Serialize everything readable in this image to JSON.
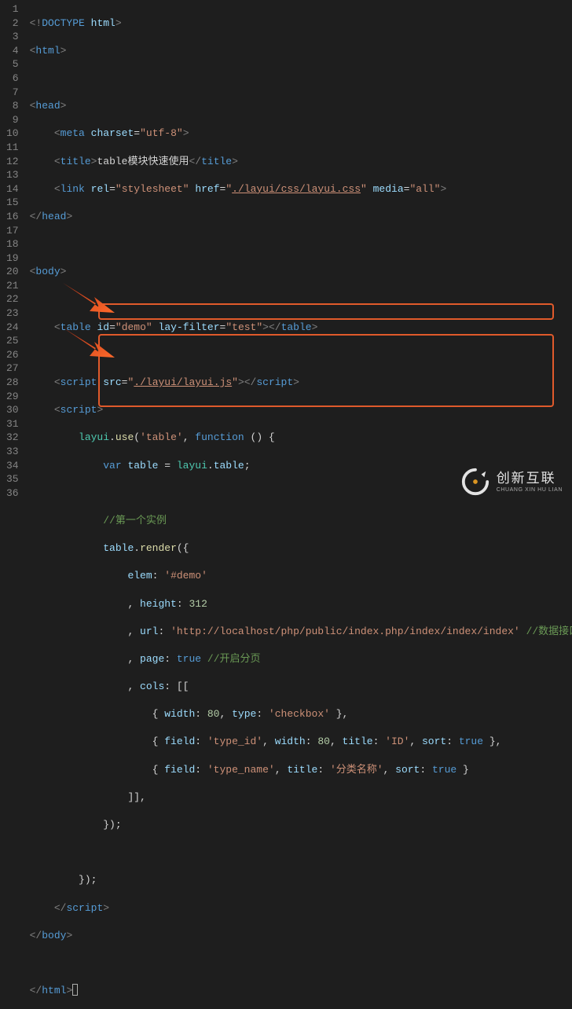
{
  "lines": [
    "1",
    "2",
    "3",
    "4",
    "5",
    "6",
    "7",
    "8",
    "9",
    "10",
    "11",
    "12",
    "13",
    "14",
    "15",
    "16",
    "17",
    "18",
    "19",
    "20",
    "21",
    "22",
    "23",
    "24",
    "25",
    "26",
    "27",
    "28",
    "29",
    "30",
    "31",
    "32",
    "33",
    "34",
    "35",
    "36"
  ],
  "code": {
    "l1": {
      "doctype": "DOCTYPE",
      "html": "html"
    },
    "l2": {
      "tag": "html"
    },
    "l4": {
      "tag": "head"
    },
    "l5": {
      "tag": "meta",
      "attr": "charset",
      "val": "\"utf-8\""
    },
    "l6": {
      "open": "title",
      "text": "table模块快速使用",
      "close": "title"
    },
    "l7": {
      "tag": "link",
      "a1": "rel",
      "v1": "\"stylesheet\"",
      "a2": "href",
      "v2": "\"",
      "href": "./layui/css/layui.css",
      "v2b": "\"",
      "a3": "media",
      "v3": "\"all\""
    },
    "l8": {
      "close": "head"
    },
    "l10": {
      "tag": "body"
    },
    "l12": {
      "tag": "table",
      "a1": "id",
      "v1": "\"demo\"",
      "a2": "lay-filter",
      "v2": "\"test\"",
      "close": "table"
    },
    "l14": {
      "tag": "script",
      "a1": "src",
      "v1": "\"",
      "src": "./layui/layui.js",
      "v1b": "\"",
      "close": "script"
    },
    "l15": {
      "tag": "script"
    },
    "l16": {
      "obj": "layui",
      "use": "use",
      "arg": "'table'",
      "kw": "function"
    },
    "l17": {
      "kw": "var",
      "name": "table",
      "obj": "layui",
      "prop": "table"
    },
    "l19": {
      "comment": "//第一个实例"
    },
    "l20": {
      "obj": "table",
      "fn": "render"
    },
    "l21": {
      "prop": "elem",
      "val": "'#demo'"
    },
    "l22": {
      "prop": "height",
      "val": "312"
    },
    "l23": {
      "prop": "url",
      "val": "'http://localhost/php/public/index.php/index/index/index'",
      "comment": "//数据接口"
    },
    "l24": {
      "prop": "page",
      "val": "true",
      "comment": "//开启分页"
    },
    "l25": {
      "prop": "cols"
    },
    "l26": {
      "p1": "width",
      "v1": "80",
      "p2": "type",
      "v2": "'checkbox'"
    },
    "l27": {
      "p1": "field",
      "v1": "'type_id'",
      "p2": "width",
      "v2": "80",
      "p3": "title",
      "v3": "'ID'",
      "p4": "sort",
      "v4": "true"
    },
    "l28": {
      "p1": "field",
      "v1": "'type_name'",
      "p2": "title",
      "v2": "'分类名称'",
      "p3": "sort",
      "v3": "true"
    },
    "l33": {
      "close": "script"
    },
    "l34": {
      "close": "body"
    },
    "l36": {
      "close": "html"
    }
  },
  "watermark": {
    "cn": "创新互联",
    "en": "CHUANG XIN HU LIAN"
  }
}
